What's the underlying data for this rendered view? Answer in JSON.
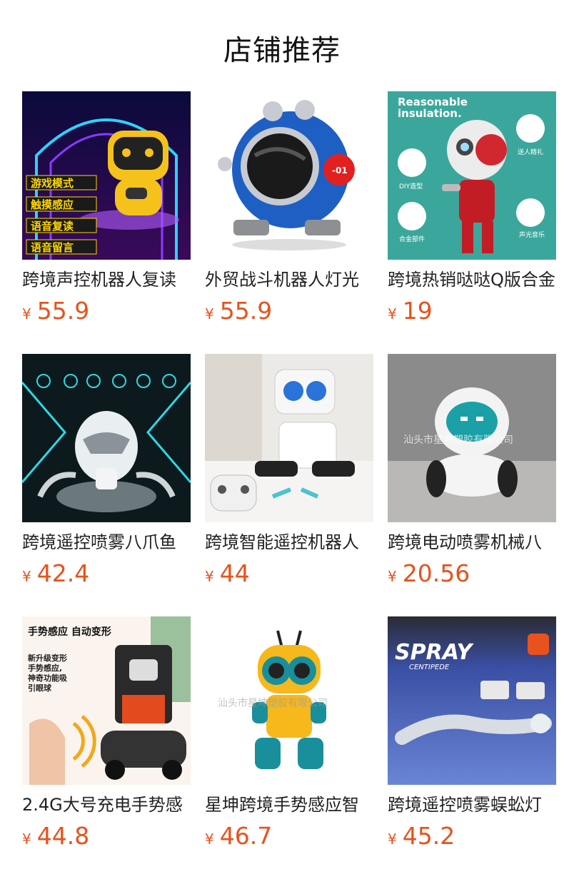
{
  "page": {
    "title": "店铺推荐"
  },
  "products": [
    {
      "name": "跨境声控机器人复读",
      "currency": "¥",
      "price": "55.9",
      "image_text": [
        "游戏模式",
        "触摸感应",
        "语音复读",
        "语音留言"
      ]
    },
    {
      "name": "外贸战斗机器人灯光",
      "currency": "¥",
      "price": "55.9",
      "image_text": [
        "-01"
      ]
    },
    {
      "name": "跨境热销哒哒Q版合金",
      "currency": "¥",
      "price": "19",
      "image_text": [
        "Reasonable",
        "insulation.",
        "DIY造型",
        "送人精礼",
        "合金部件",
        "声光音乐"
      ]
    },
    {
      "name": "跨境遥控喷雾八爪鱼",
      "currency": "¥",
      "price": "42.4",
      "image_text": []
    },
    {
      "name": "跨境智能遥控机器人",
      "currency": "¥",
      "price": "44",
      "image_text": []
    },
    {
      "name": "跨境电动喷雾机械八",
      "currency": "¥",
      "price": "20.56",
      "image_text": [
        "汕头市星坤塑胶有限公司"
      ]
    },
    {
      "name": "2.4G大号充电手势感",
      "currency": "¥",
      "price": "44.8",
      "image_text": [
        "手势感应 自动变形",
        "新升级变形",
        "手势感应,",
        "神奇功能吸",
        "引眼球"
      ]
    },
    {
      "name": "星坤跨境手势感应智",
      "currency": "¥",
      "price": "46.7",
      "image_text": [
        "汕头市星坤塑胶有限公司"
      ]
    },
    {
      "name": "跨境遥控喷雾蜈蚣灯",
      "currency": "¥",
      "price": "45.2",
      "image_text": [
        "SPRAY",
        "CENTIPEDE"
      ]
    }
  ],
  "colors": {
    "price": "#e8521c",
    "text": "#222222"
  }
}
